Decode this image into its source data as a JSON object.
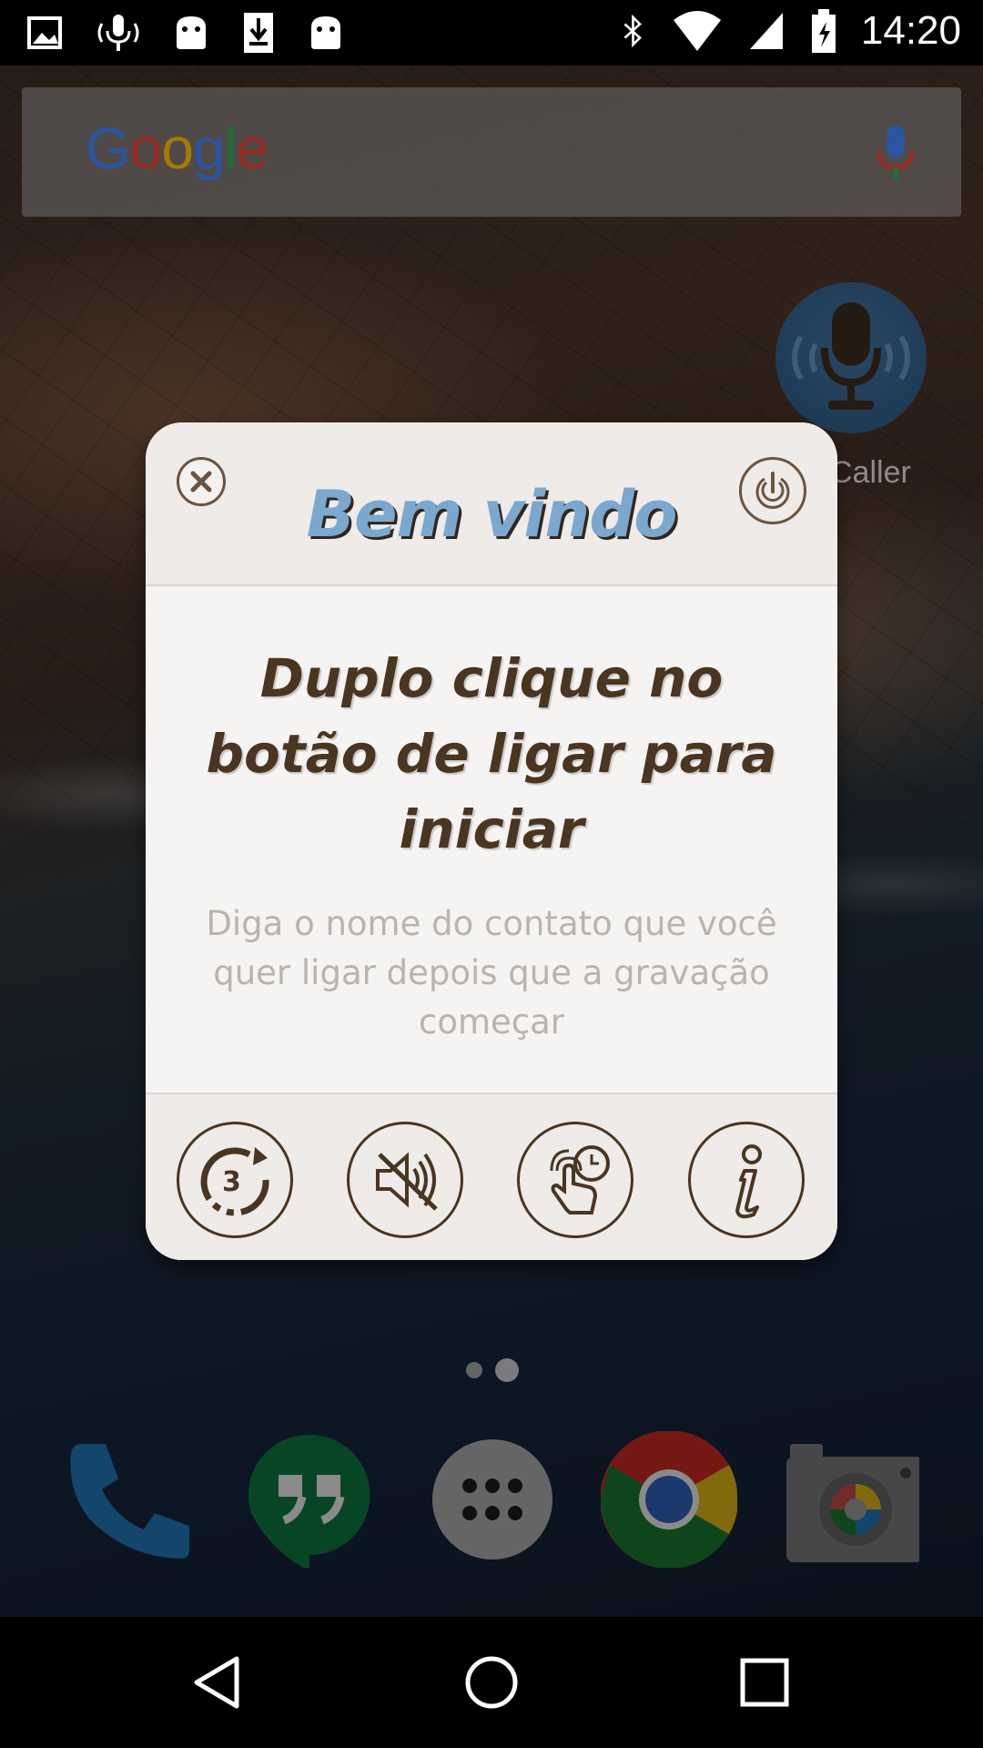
{
  "status_bar": {
    "time": "14:20",
    "left_icons": [
      "image-icon",
      "voice-icon",
      "android-icon",
      "download-icon",
      "android-icon"
    ],
    "right_icons": [
      "bluetooth-icon",
      "wifi-icon",
      "signal-icon",
      "battery-icon"
    ]
  },
  "search_widget": {
    "logo": "Google",
    "logo_colors": [
      "#4285F4",
      "#EA4335",
      "#FBBC05",
      "#4285F4",
      "#34A853",
      "#EA4335"
    ]
  },
  "desktop": {
    "app_label": "Caller",
    "page_dots": [
      false,
      true
    ]
  },
  "dialog": {
    "title": "Bem vindo",
    "headline": "Duplo clique no botão de ligar para iniciar",
    "description": "Diga o nome do contato que você quer ligar depois que a gravação começar",
    "footer_icons": [
      "countdown-3-icon",
      "mute-icon",
      "touch-timer-icon",
      "info-icon"
    ]
  },
  "dock": {
    "apps": [
      "phone-icon",
      "hangouts-icon",
      "app-drawer-icon",
      "chrome-icon",
      "camera-icon"
    ]
  },
  "nav_bar": {
    "buttons": [
      "back-icon",
      "home-icon",
      "recents-icon"
    ]
  },
  "colors": {
    "dialog_title": "#7ba8cf",
    "dialog_text": "#4a3521",
    "dialog_desc": "#b7b4b1",
    "dialog_bg": "#f5f4f3"
  }
}
